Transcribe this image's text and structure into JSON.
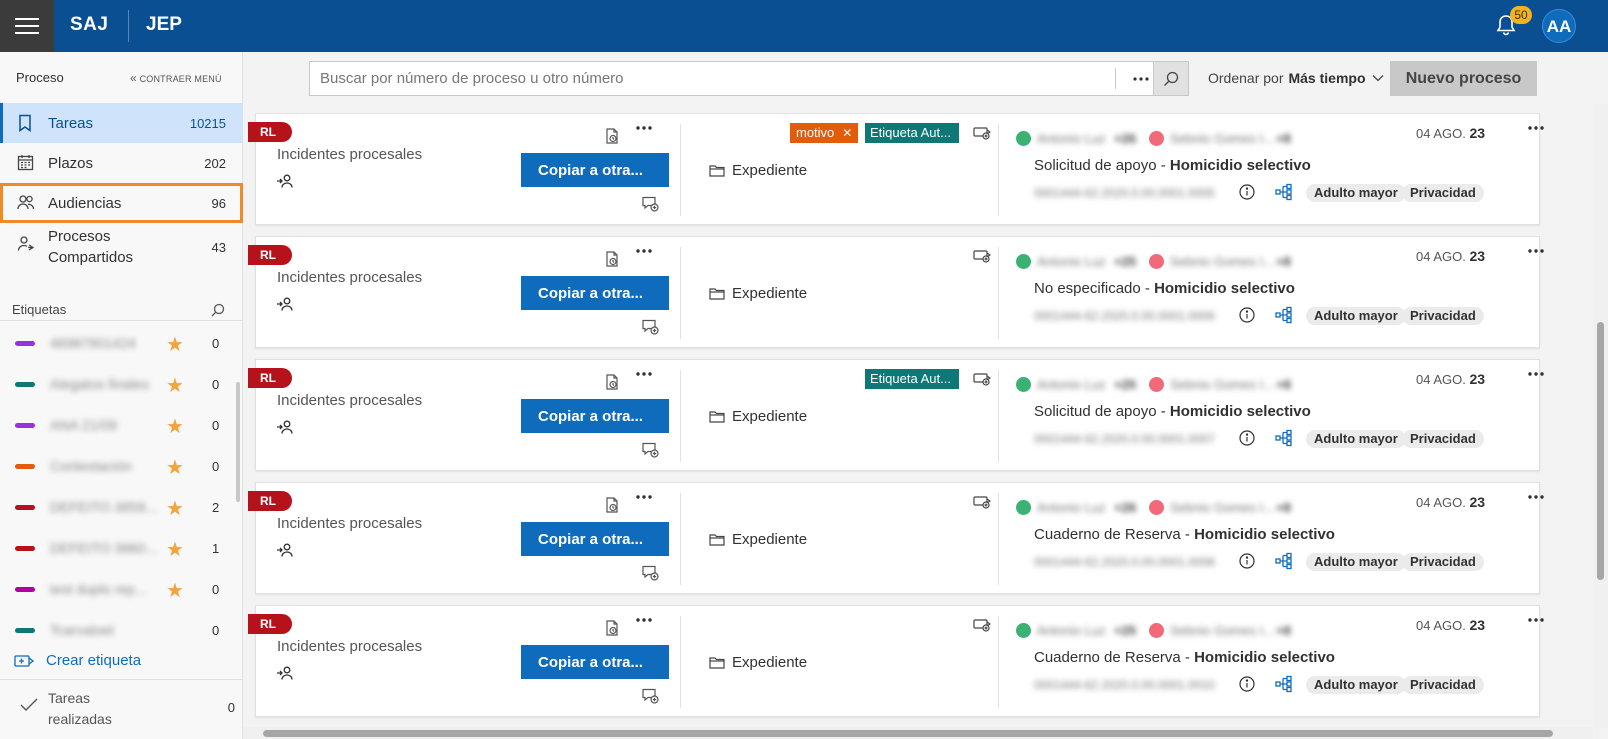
{
  "header": {
    "brand": "SAJ",
    "module": "JEP",
    "notifications": "50",
    "avatar": "AA"
  },
  "sidebar": {
    "section": "Proceso",
    "collapse": "CONTRAER MENÚ",
    "items": [
      {
        "label": "Tareas",
        "count": "10215"
      },
      {
        "label": "Plazos",
        "count": "202"
      },
      {
        "label": "Audiencias",
        "count": "96"
      },
      {
        "label": "Procesos Compartidos",
        "count": "43"
      }
    ],
    "tags_title": "Etiquetas",
    "tags": [
      {
        "name": "46987901424",
        "color": "#9b30e0",
        "count": "0"
      },
      {
        "name": "Alegatos finales",
        "color": "#0e7877",
        "count": "0"
      },
      {
        "name": "ANA 21/09",
        "color": "#9b30e0",
        "count": "0"
      },
      {
        "name": "Contestación",
        "color": "#e35c0b",
        "count": "0"
      },
      {
        "name": "DEFEITO 3859...",
        "color": "#b5121b",
        "count": "2"
      },
      {
        "name": "DEFEITO 3860...",
        "color": "#b5121b",
        "count": "1"
      },
      {
        "name": "test duplo rep...",
        "color": "#b4009e",
        "count": "0"
      },
      {
        "name": "Tcarvaloet",
        "color": "#0e7877",
        "count": "0"
      }
    ],
    "create_tag": "Crear etiqueta",
    "done": {
      "label": "Tareas realizadas",
      "count": "0"
    }
  },
  "toolbar": {
    "search_placeholder": "Buscar por número de proceso u otro número",
    "sort_prefix": "Ordenar por",
    "sort_value": "Más tiempo",
    "new_process": "Nuevo proceso"
  },
  "cards": [
    {
      "badge": "RL",
      "title": "Incidentes procesales",
      "copy": "Copiar a otra...",
      "folder": "Expediente",
      "tag1": "motivo",
      "tag2": "Etiqueta Aut...",
      "person1": "Antonio Luz",
      "count1": "+26",
      "person2": "Sebnio Gomes I...",
      "count2": "+8",
      "date": "04 AGO.",
      "year": "23",
      "subject": "Solicitud de apoyo - ",
      "subject_bold": "Homicidio selectivo",
      "number": "0001444-62.2020.0.00.0001.0005",
      "chip1": "Adulto mayor",
      "chip2": "Privacidad"
    },
    {
      "badge": "RL",
      "title": "Incidentes procesales",
      "copy": "Copiar a otra...",
      "folder": "Expediente",
      "person1": "Antonio Luz",
      "count1": "+25",
      "person2": "Sebnio Gomes I...",
      "count2": "+8",
      "date": "04 AGO.",
      "year": "23",
      "subject": "No especificado - ",
      "subject_bold": "Homicidio selectivo",
      "number": "0001444-62.2020.0.00.0001.0006",
      "chip1": "Adulto mayor",
      "chip2": "Privacidad"
    },
    {
      "badge": "RL",
      "title": "Incidentes procesales",
      "copy": "Copiar a otra...",
      "folder": "Expediente",
      "tag2": "Etiqueta Aut...",
      "person1": "Antonio Luz",
      "count1": "+25",
      "person2": "Sebnio Gomes I...",
      "count2": "+8",
      "date": "04 AGO.",
      "year": "23",
      "subject": "Solicitud de apoyo - ",
      "subject_bold": "Homicidio selectivo",
      "number": "0001444-62.2020.0.00.0001.0007",
      "chip1": "Adulto mayor",
      "chip2": "Privacidad"
    },
    {
      "badge": "RL",
      "title": "Incidentes procesales",
      "copy": "Copiar a otra...",
      "folder": "Expediente",
      "person1": "Antonio Luz",
      "count1": "+26",
      "person2": "Sebnio Gomes I...",
      "count2": "+8",
      "date": "04 AGO.",
      "year": "23",
      "subject": "Cuaderno de Reserva - ",
      "subject_bold": "Homicidio selectivo",
      "number": "0001444-62.2020.0.00.0001.0008",
      "chip1": "Adulto mayor",
      "chip2": "Privacidad"
    },
    {
      "badge": "RL",
      "title": "Incidentes procesales",
      "copy": "Copiar a otra...",
      "folder": "Expediente",
      "person1": "Antonio Luz",
      "count1": "+25",
      "person2": "Sebnio Gomes I...",
      "count2": "+8",
      "date": "04 AGO.",
      "year": "23",
      "subject": "Cuaderno de Reserva - ",
      "subject_bold": "Homicidio selectivo",
      "number": "0001444-62.2020.0.00.0001.0010",
      "chip1": "Adulto mayor",
      "chip2": "Privacidad"
    }
  ],
  "colors": {
    "header": "#0b4f93",
    "primary": "#0f6cbd",
    "highlight": "#ef8a2b",
    "badge": "#b5121b",
    "avatar_green": "#3bb273",
    "avatar_red": "#f06a7a"
  },
  "icons": [
    "menu-icon",
    "bell-icon",
    "collapse-chevron-icon",
    "bookmark-icon",
    "calendar-icon",
    "people-icon",
    "shared-people-icon",
    "search-icon",
    "star-icon",
    "create-tag-icon",
    "check-icon",
    "more-icon",
    "history-icon",
    "assign-icon",
    "comment-add-icon",
    "folder-icon",
    "tag-add-icon",
    "info-icon",
    "tree-icon",
    "close-icon",
    "chevron-down-icon"
  ]
}
